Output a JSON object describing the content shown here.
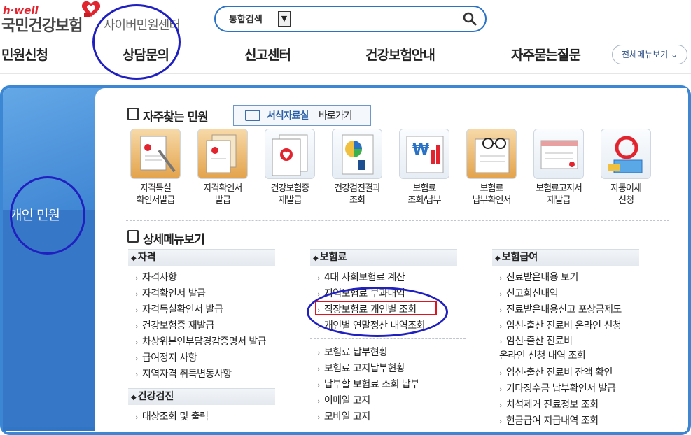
{
  "header": {
    "logo_hwell": "h·well",
    "logo_name": "국민건강보험",
    "logo_subtitle": "사이버민원센터",
    "search": {
      "scope": "통합검색",
      "scope_toggle": "▼",
      "placeholder": ""
    }
  },
  "nav": {
    "items": [
      "민원신청",
      "상담문의",
      "신고센터",
      "건강보험안내",
      "자주묻는질문"
    ],
    "all_menu": "전체메뉴보기 ⌄"
  },
  "side": {
    "title": "개인 민원"
  },
  "frequent": {
    "title": "자주찾는 민원",
    "forms_link_1": "서식자료실",
    "forms_link_2": "바로가기",
    "items": [
      {
        "label": "자격득실\n확인서발급",
        "icon": "document-pen-icon"
      },
      {
        "label": "자격확인서\n발급",
        "icon": "documents-stamp-icon"
      },
      {
        "label": "건강보험증\n재발급",
        "icon": "insurance-card-icon"
      },
      {
        "label": "건강검진결과\n조회",
        "icon": "health-checkup-chart-icon"
      },
      {
        "label": "보험료\n조회/납부",
        "icon": "won-bar-chart-icon"
      },
      {
        "label": "보험료\n납부확인서",
        "icon": "glasses-receipt-icon"
      },
      {
        "label": "보험료고지서\n재발급",
        "icon": "bill-statement-icon"
      },
      {
        "label": "자동이체\n신청",
        "icon": "auto-transfer-icon"
      }
    ]
  },
  "detail": {
    "title": "상세메뉴보기",
    "col1": {
      "header": "자격",
      "links": [
        "자격사항",
        "자격확인서 발급",
        "자격득실확인서 발급",
        "건강보험증 재발급",
        "차상위본인부담경감증명서 발급",
        "급여정지 사항",
        "지역자격 취득변동사항"
      ],
      "header2": "건강검진",
      "links2": [
        "대상조회 및 출력"
      ]
    },
    "col2": {
      "header": "보험료",
      "links": [
        "4대 사회보험료 계산",
        "지역보험료 부과내역",
        "직장보험료 개인별 조회",
        "개인별 연말정산 내역조회"
      ],
      "links2": [
        "보험료 납부현황",
        "보험료 고지납부현황",
        "납부할 보험료 조회 납부",
        "이메일 고지",
        "모바일 고지"
      ]
    },
    "col3": {
      "header": "보험급여",
      "links": [
        "진료받은내용 보기",
        "신고회신내역",
        "진료받은내용신고 포상금제도",
        "임신·출산 진료비 온라인 신청",
        "임신·출산 진료비\n온라인 신청 내역 조회",
        "임신·출산 진료비 잔액 확인",
        "기타징수금 납부확인서 발급",
        "치석제거 진료정보 조회",
        "현금급여 지급내역 조회"
      ]
    }
  },
  "colors": {
    "accent": "#3c87d3",
    "highlight_box": "#e0141e",
    "annotation_ellipse": "#2020c0"
  }
}
